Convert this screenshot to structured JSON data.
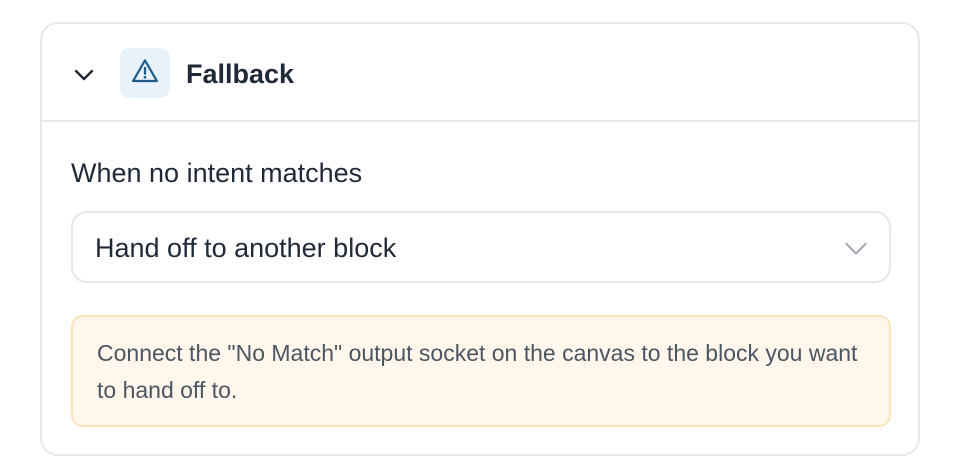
{
  "section": {
    "title": "Fallback",
    "expanded": true,
    "icon": "warning-triangle-icon",
    "icon_color": "#1e5a8a",
    "icon_bg": "#e8f2fb"
  },
  "fallback": {
    "label": "When no intent matches",
    "selected": "Hand off to another block",
    "notice": "Connect the \"No Match\" output socket on the canvas to the block you want to hand off to."
  },
  "colors": {
    "border": "#e5e7eb",
    "notice_bg": "#fff7eb",
    "notice_border": "#fde3b8"
  }
}
